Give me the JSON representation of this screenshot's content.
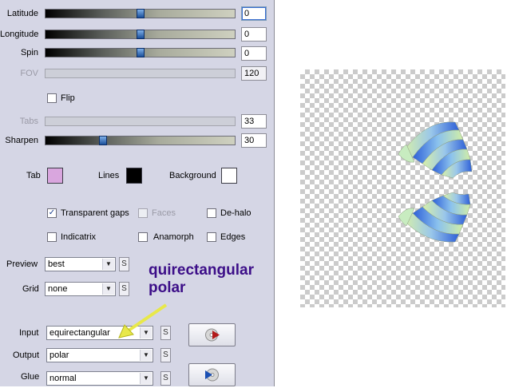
{
  "sliders": {
    "latitude": {
      "label": "Latitude",
      "value": "0",
      "level": 0.5,
      "disabled": false
    },
    "longitude": {
      "label": "Longitude",
      "value": "0",
      "level": 0.5,
      "disabled": false
    },
    "spin": {
      "label": "Spin",
      "value": "0",
      "level": 0.5,
      "disabled": false
    },
    "fov": {
      "label": "FOV",
      "value": "120",
      "disabled": true
    },
    "tabs": {
      "label": "Tabs",
      "value": "33",
      "disabled": true
    },
    "sharpen": {
      "label": "Sharpen",
      "value": "30",
      "level": 0.3,
      "disabled": false
    }
  },
  "flip": {
    "label": "Flip",
    "checked": false
  },
  "colors": {
    "tab": {
      "label": "Tab",
      "color": "#d9a6de"
    },
    "lines": {
      "label": "Lines",
      "color": "#000000"
    },
    "background": {
      "label": "Background",
      "color": "#ffffff"
    }
  },
  "options": {
    "transparent_gaps": {
      "label": "Transparent gaps",
      "checked": true
    },
    "faces": {
      "label": "Faces",
      "checked": false,
      "disabled": true
    },
    "dehalo": {
      "label": "De-halo",
      "checked": false
    },
    "indicatrix": {
      "label": "Indicatrix",
      "checked": false
    },
    "anamorph": {
      "label": "Anamorph",
      "checked": false
    },
    "edges": {
      "label": "Edges",
      "checked": false
    }
  },
  "selects": {
    "preview": {
      "label": "Preview",
      "value": "best"
    },
    "grid": {
      "label": "Grid",
      "value": "none"
    },
    "input": {
      "label": "Input",
      "value": "equirectangular"
    },
    "output": {
      "label": "Output",
      "value": "polar"
    },
    "glue": {
      "label": "Glue",
      "value": "normal"
    }
  },
  "s_button_label": "S",
  "annotation": {
    "line1": "quirectangular",
    "line2": "polar",
    "color": "#3c0e88"
  },
  "accent_color": "#1a4f9a"
}
